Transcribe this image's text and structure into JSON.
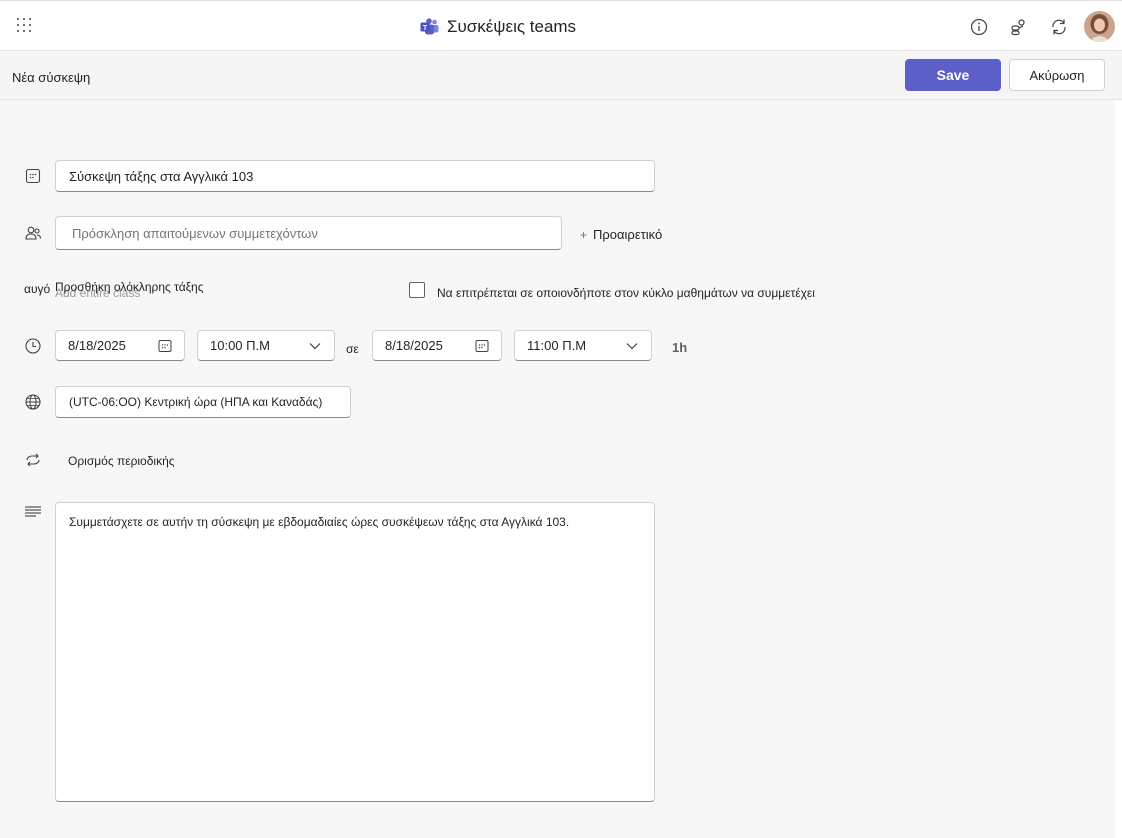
{
  "header": {
    "app_title": "Συσκέψεις teams",
    "icons": [
      "waffle-icon",
      "teams-logo-icon",
      "info-icon",
      "share-icon",
      "refresh-icon",
      "avatar"
    ]
  },
  "command_bar": {
    "page_title": "Νέα σύσκεψη",
    "save_label": "Save",
    "cancel_label": "Ακύρωση"
  },
  "form": {
    "title": {
      "value": "Σύσκεψη τάξης στα Αγγλικά 103",
      "icon": "calendar-icon"
    },
    "attendees": {
      "placeholder": "Πρόσκληση απαιτούμενων συμμετεχόντων",
      "icon": "people-icon",
      "optional_label": "Προαιρετικό",
      "optional_symbol": "+"
    },
    "channel": {
      "label": "αυγό",
      "value": "Προσθήκη ολόκληρης τάξης",
      "ghost_text": "Add entire class"
    },
    "allow_anyone": {
      "label": "Να επιτρέπεται σε οποιονδήποτε στον κύκλο μαθημάτων να συμμετέχει",
      "checked": false
    },
    "schedule": {
      "start_date": "8/18/2025",
      "start_time": "10:00",
      "start_period": "π.μ",
      "to_label": "σε",
      "end_date": "8/18/2025",
      "end_time": "11:00",
      "end_period": "π.μ",
      "duration": "1h"
    },
    "timezone": {
      "value": "(UTC-06:OO) Κεντρική ώρα (ΗΠΑ και Καναδάς)",
      "icon": "globe-icon"
    },
    "recurrence": {
      "label": "Ορισμός περιοδικής",
      "icon": "repeat-icon"
    },
    "details": {
      "value": "Συμμετάσχετε σε αυτήν τη σύσκεψη με εβδομαδιαίες ώρες συσκέψεων τάξης στα Αγγλικά 103.",
      "icon": "text-lines-icon"
    }
  },
  "colors": {
    "accent": "#5b5fc7",
    "border": "#d1d1d1",
    "background": "#f7f7f7"
  }
}
